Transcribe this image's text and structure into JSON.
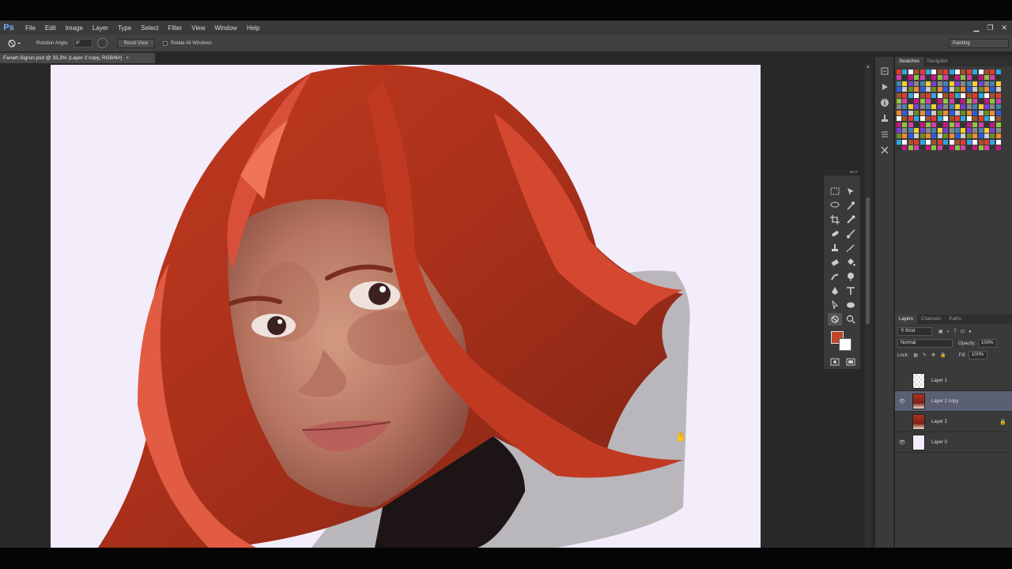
{
  "menubar": {
    "logo": "Ps",
    "items": [
      "File",
      "Edit",
      "Image",
      "Layer",
      "Type",
      "Select",
      "Filter",
      "View",
      "Window",
      "Help"
    ]
  },
  "options": {
    "rotation_label": "Rotation Angle:",
    "rotation_value": "0°",
    "reset_view": "Reset View",
    "rotate_all": "Rotate All Windows",
    "workspace": "Painting"
  },
  "document": {
    "tab_title": "Fanart-Sigrun.psd @ 33,3% (Layer 2 copy, RGB/8#)",
    "close": "×"
  },
  "swatches_panel": {
    "tabs": [
      "Swatches",
      "Navigator"
    ]
  },
  "layers_panel": {
    "tabs": [
      "Layers",
      "Channels",
      "Paths"
    ],
    "filter": "Kind",
    "blend_mode": "Normal",
    "opacity_label": "Opacity:",
    "opacity": "100%",
    "lock_label": "Lock:",
    "fill_label": "Fill:",
    "fill": "100%",
    "layers": [
      {
        "name": "Layer 1",
        "visible": false,
        "active": false,
        "locked": false
      },
      {
        "name": "Layer 2 copy",
        "visible": true,
        "active": true,
        "locked": false
      },
      {
        "name": "Layer 2",
        "visible": false,
        "active": false,
        "locked": true
      },
      {
        "name": "Layer 0",
        "visible": true,
        "active": false,
        "locked": false
      }
    ]
  },
  "colors": {
    "foreground": "#c0452b",
    "background": "#ffffff",
    "accent_selected_layer": "#5a5f73"
  }
}
